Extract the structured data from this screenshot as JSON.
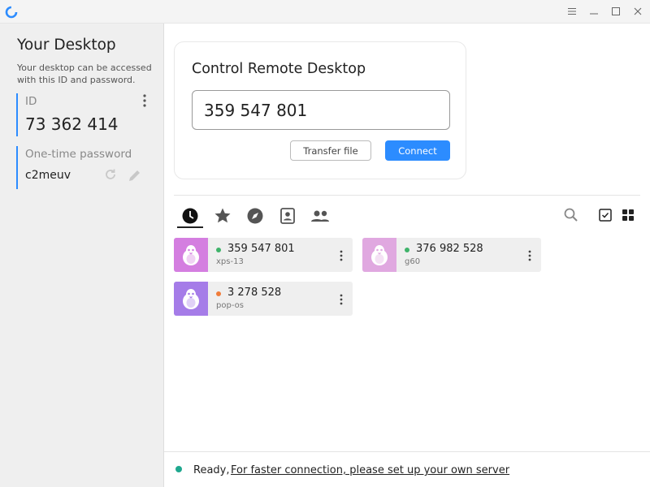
{
  "colors": {
    "accent": "#2c8cff",
    "online": "#3fb36a",
    "away": "#f07c3a",
    "avatar_pink": "#d47ee0",
    "avatar_light_pink": "#e0a8e0",
    "avatar_purple": "#a57ce8"
  },
  "titlebar": {
    "logo_icon": "rustdesk-logo-icon",
    "menu_icon": "hamburger-icon",
    "minimize_icon": "minimize-icon",
    "maximize_icon": "maximize-icon",
    "close_icon": "close-icon"
  },
  "sidebar": {
    "title": "Your Desktop",
    "description": "Your desktop can be accessed with this ID and password.",
    "id_label": "ID",
    "id_value": "73 362 414",
    "password_label": "One-time password",
    "password_value": "c2meuv"
  },
  "connect_card": {
    "title": "Control Remote Desktop",
    "input_value": "359 547 801",
    "transfer_label": "Transfer file",
    "connect_label": "Connect"
  },
  "tabs": [
    {
      "name": "recent",
      "icon": "clock-icon",
      "active": true
    },
    {
      "name": "favorites",
      "icon": "star-icon",
      "active": false
    },
    {
      "name": "discovered",
      "icon": "compass-icon",
      "active": false
    },
    {
      "name": "address-book",
      "icon": "contact-book-icon",
      "active": false
    },
    {
      "name": "group",
      "icon": "people-icon",
      "active": false
    }
  ],
  "toolbar": {
    "search_icon": "search-icon",
    "select_icon": "checkbox-icon",
    "view_icon": "grid-view-icon"
  },
  "peers": [
    {
      "id": "359 547 801",
      "name": "xps-13",
      "status": "online",
      "avatar_icon": "linux-penguin-icon"
    },
    {
      "id": "376 982 528",
      "name": "g60",
      "status": "online",
      "avatar_icon": "linux-penguin-icon"
    },
    {
      "id": "3 278 528",
      "name": "pop-os",
      "status": "away",
      "avatar_icon": "linux-penguin-icon"
    }
  ],
  "status": {
    "text": "Ready,",
    "link": "For faster connection, please set up your own server"
  }
}
